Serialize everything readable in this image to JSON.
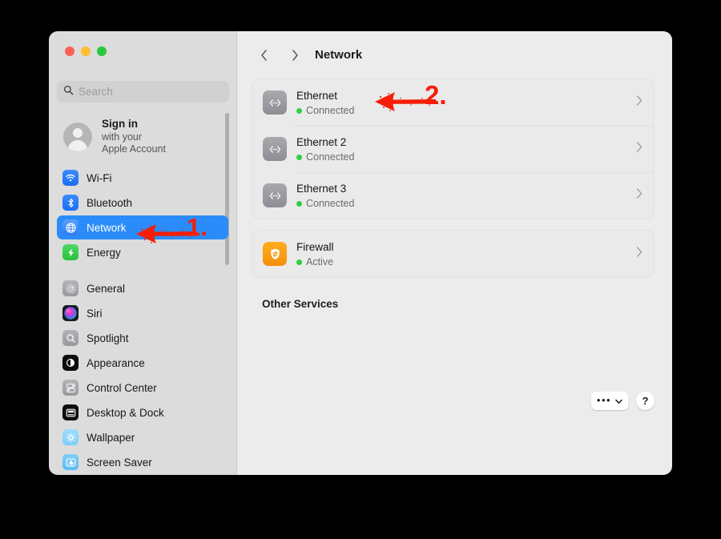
{
  "window": {
    "traffic_lights": [
      "close",
      "minimize",
      "maximize"
    ],
    "colors": {
      "close": "#ff6054",
      "minimize": "#ffbd2f",
      "maximize": "#29c93f",
      "accent": "#2b8cf9",
      "status_green": "#30cf3e",
      "annotation_red": "#f61e07",
      "sidebar_bg": "#dcdcdc",
      "content_bg": "#ececec"
    }
  },
  "sidebar": {
    "search": {
      "value": "",
      "placeholder": "Search",
      "icon": "search-icon"
    },
    "account": {
      "title": "Sign in",
      "line2": "with your",
      "line3": "Apple Account",
      "avatar_icon": "person-avatar-icon"
    },
    "groups": [
      {
        "items": [
          {
            "label": "Wi-Fi",
            "icon": "wifi-icon",
            "selected": false
          },
          {
            "label": "Bluetooth",
            "icon": "bluetooth-icon",
            "selected": false
          },
          {
            "label": "Network",
            "icon": "globe-icon",
            "selected": true
          },
          {
            "label": "Energy",
            "icon": "bolt-icon",
            "selected": false
          }
        ]
      },
      {
        "items": [
          {
            "label": "General",
            "icon": "gear-icon",
            "selected": false
          },
          {
            "label": "Siri",
            "icon": "siri-icon",
            "selected": false
          },
          {
            "label": "Spotlight",
            "icon": "spotlight-search-icon",
            "selected": false
          },
          {
            "label": "Appearance",
            "icon": "appearance-contrast-icon",
            "selected": false
          },
          {
            "label": "Control Center",
            "icon": "control-center-icon",
            "selected": false
          },
          {
            "label": "Desktop & Dock",
            "icon": "desktop-dock-icon",
            "selected": false
          },
          {
            "label": "Wallpaper",
            "icon": "wallpaper-icon",
            "selected": false
          },
          {
            "label": "Screen Saver",
            "icon": "screen-saver-icon",
            "selected": false
          }
        ]
      }
    ]
  },
  "toolbar": {
    "back_icon": "chevron-left-icon",
    "forward_icon": "chevron-right-icon",
    "title": "Network"
  },
  "main": {
    "service_cards": [
      {
        "rows": [
          {
            "name": "Ethernet",
            "status": "Connected",
            "icon": "ethernet-icon",
            "icon_style": "eth"
          },
          {
            "name": "Ethernet 2",
            "status": "Connected",
            "icon": "ethernet-icon",
            "icon_style": "eth"
          },
          {
            "name": "Ethernet 3",
            "status": "Connected",
            "icon": "ethernet-icon",
            "icon_style": "eth"
          }
        ]
      },
      {
        "rows": [
          {
            "name": "Firewall",
            "status": "Active",
            "icon": "firewall-shield-icon",
            "icon_style": "fw"
          }
        ]
      }
    ],
    "other_services_heading": "Other Services",
    "buttons": {
      "more_label": "•••",
      "more_icon": "chevron-down-icon",
      "help_label": "?"
    }
  },
  "annotations": [
    {
      "number": "1.",
      "target": "sidebar-item-network",
      "direction": "left"
    },
    {
      "number": "2.",
      "target": "service-row-ethernet",
      "direction": "left"
    }
  ]
}
